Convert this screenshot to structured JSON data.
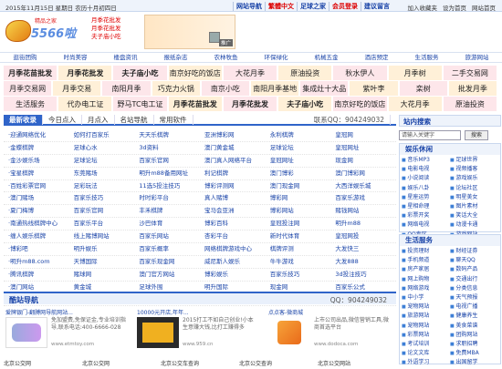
{
  "topbar": {
    "date": "2015年11月15日 星期日 农历十月初四日",
    "links": [
      "网站导航",
      "繁體中文",
      "足球之家",
      "会员登录",
      "建议留言"
    ],
    "right_links": [
      "加入收藏夹",
      "设为首页",
      "网站首页"
    ]
  },
  "logo": {
    "tagline": "精品之家",
    "name": "5566啦"
  },
  "hotlist": [
    "月季花批发",
    "月季花批发",
    "夫子庙小吃"
  ],
  "banner": {
    "ad_label": "推广"
  },
  "nav1": [
    "逛街团购",
    "时尚美容",
    "楼盘资讯",
    "报纸杂志",
    "农林牧鱼",
    "环保绿化",
    "机械五金",
    "酒店预定",
    "生活服务",
    "旅游网站"
  ],
  "keywords": [
    [
      "月季花苗批发",
      "月季花批发",
      "夫子庙小吃",
      "南京好吃的饭店",
      "大花月季",
      "原油投资",
      "秋水伊人",
      "月季树",
      "二手交易网"
    ],
    [
      "月季交易网",
      "月季交易",
      "南阳月季",
      "巧克力火锅",
      "南京小吃",
      "南阳月季基地",
      "集成灶十大品牌",
      "紫叶李",
      "栾树",
      "批发月季"
    ],
    [
      "生活服务",
      "代办电工证",
      "野马TC电工证",
      "月季花苗批发",
      "月季花批发",
      "夫子庙小吃",
      "南京好吃的饭店",
      "大花月季",
      "原油投资"
    ]
  ],
  "tabs": {
    "items": [
      "最新收录",
      "今日点入",
      "月点入",
      "名站导航",
      "常用软件"
    ],
    "qq": "联系QQ：904249032"
  },
  "list": [
    [
      "·迎通网络优化",
      "如何打百家乐",
      "天天乐棋牌",
      "亚洲博彩网",
      "永利棋牌",
      "皇冠网"
    ],
    [
      "·金蝶棋牌",
      "足球心水",
      "3d资料",
      "澳门黄金城",
      "足球论坛",
      "皇冠网址"
    ],
    [
      "·金沙娱乐场",
      "足球论坛",
      "百家乐官网",
      "澳门真人网络平台",
      "皇冠网址",
      "现金网"
    ],
    [
      "·宝星棋牌",
      "东莞赌场",
      "明升m88备用网址",
      "利记棋牌",
      "澳门博彩",
      "澳门博彩网"
    ],
    [
      "·百姓彩票官网",
      "足彩玩法",
      "11选5投注技巧",
      "博彩评测网",
      "澳门现金网",
      "大西洋娱乐城"
    ],
    [
      "·澳门赌场",
      "百家乐技巧",
      "时时彩平台",
      "真人赌博",
      "博彩网",
      "百家乐游戏"
    ],
    [
      "·夏门梅博",
      "百家乐官网",
      "丰禾棋牌",
      "宝马会亚洲",
      "博彩网站",
      "赌钱网站"
    ],
    [
      "·南通热线棋牌中心",
      "百家乐平台",
      "沙巴体育",
      "博彩百科",
      "皇冠投注网",
      "明升m88"
    ],
    [
      "·缠人娱乐棋牌",
      "线上赌博网站",
      "百家乐网站",
      "杏彩平台",
      "新时代体育",
      "皇冠网投"
    ],
    [
      "·博彩吧",
      "明升娱乐",
      "百家乐概率",
      "网络棋牌游戏中心",
      "棋牌评测",
      "大发快三"
    ],
    [
      "·明升m88.com",
      "天博国际",
      "百家乐现金网",
      "威尼斯人娱乐",
      "牛牛游戏",
      "大发888"
    ],
    [
      "·腾讯棋牌",
      "赌球网",
      "澳门官方网站",
      "博彩娱乐",
      "百家乐技巧",
      "3d投注技巧"
    ],
    [
      "·澳门网站",
      "黄金城",
      "足球外围",
      "明升国际",
      "现金网",
      "百家乐公式"
    ],
    [
      "·我来牛技巧",
      "网上体育",
      "博之道娱乐城",
      "博彩网站",
      "双色球开奖",
      "更多最新收录网站"
    ]
  ],
  "kuzhan": {
    "title": "酷站导航",
    "qq": "QQ：904249032"
  },
  "cards": [
    {
      "title": "爱牌银门-翻膊网导航网站...",
      "desc": "免加盟费,免保证金,专业培训指导,联系电话:400-6666-028",
      "url": "www.etmtoy.com"
    },
    {
      "title": "10000元开店,年年...",
      "desc": "2015打工不如自己创业!小本生意赚大钱,比打工赚得多",
      "url": "www.959.cn"
    },
    {
      "title": "点点客-微商城",
      "desc": "上市公司出品,微信营销工具,微商首选平台",
      "url": "www.dodoca.com"
    }
  ],
  "bottom_line": [
    "北京公交网",
    "北京公交网",
    "北京公交车查询",
    "北京公交查询",
    "北京公交网站"
  ],
  "side": {
    "search_title": "站内搜索",
    "search_placeholder": "请输入关键字",
    "search_button": "搜索",
    "fun_title": "娱乐休闲",
    "fun_items": [
      "音乐MP3",
      "足球世界",
      "电影电视",
      "视频播客",
      "小说阅读",
      "游戏娱乐",
      "娱乐八卦",
      "论坛社区",
      "星座运势",
      "明星美女",
      "星相命理",
      "图片素材",
      "彩票开奖",
      "笑话大全",
      "网络电视",
      "动漫卡通",
      "QQ专区",
      "游戏网站"
    ],
    "life_title": "生活服务",
    "life_items": [
      "投资理财",
      "财经证券",
      "手机频道",
      "聊天QQ",
      "房产家居",
      "数码产品",
      "网上购物",
      "交通出行",
      "网络游戏",
      "分类信息",
      "中小学",
      "天气预报",
      "宠物网站",
      "电视广播",
      "旅游网站",
      "健康养生",
      "宠物网站",
      "美食菜谱",
      "彩票网站",
      "团购网站",
      "考试培训",
      "求职招聘",
      "论文文库",
      "免费MBA",
      "外语学习",
      "出国留学"
    ]
  }
}
